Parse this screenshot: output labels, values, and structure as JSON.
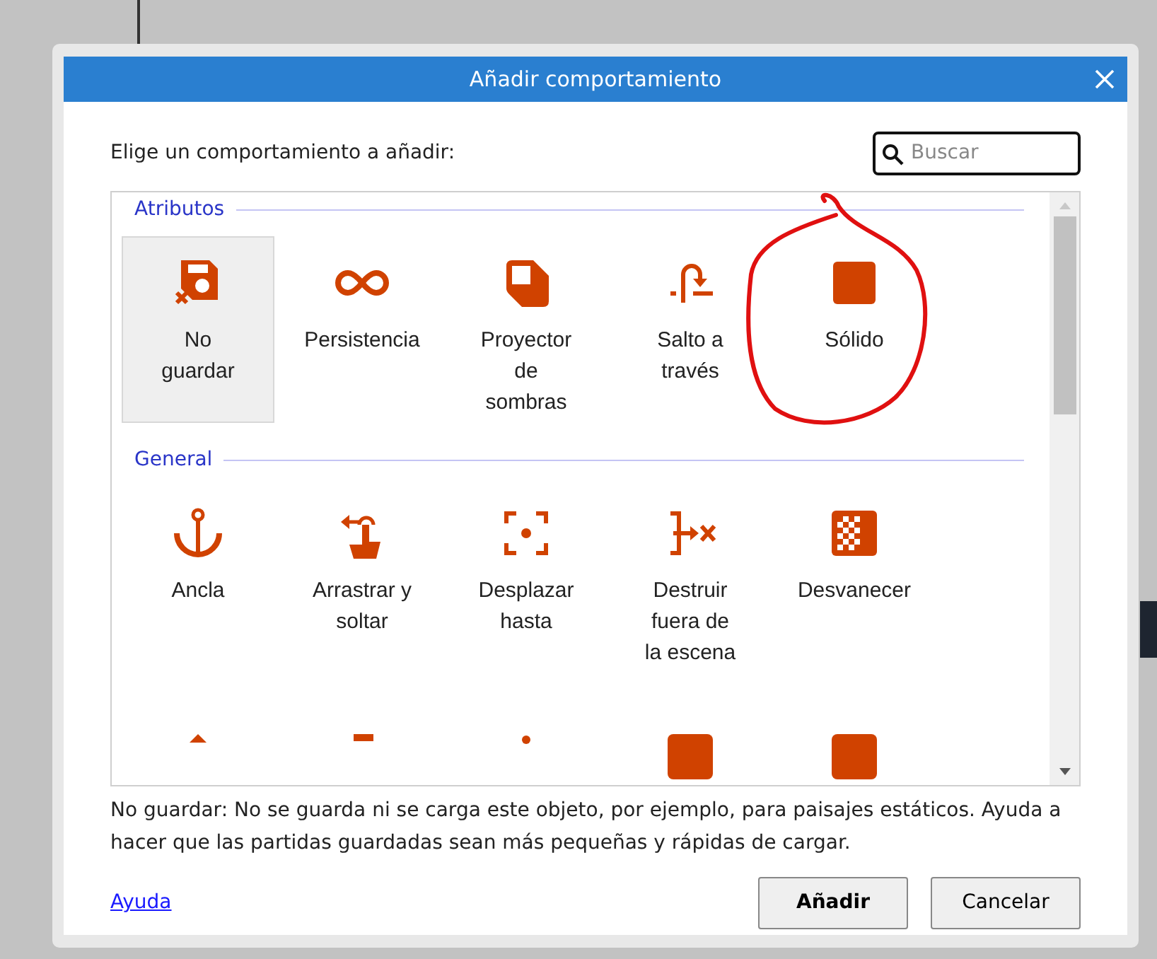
{
  "window": {
    "title": "Añadir comportamiento"
  },
  "prompt": "Elige un comportamiento a añadir:",
  "search": {
    "placeholder": "Buscar"
  },
  "groups": [
    {
      "title": "Atributos",
      "items": [
        {
          "label": "No guardar",
          "kind": "nosave",
          "selected": true
        },
        {
          "label": "Persistencia",
          "kind": "infinity",
          "selected": false
        },
        {
          "label": "Proyector de sombras",
          "kind": "shadow",
          "selected": false
        },
        {
          "label": "Salto a través",
          "kind": "jumpthru",
          "selected": false
        },
        {
          "label": "Sólido",
          "kind": "solid",
          "selected": false
        }
      ]
    },
    {
      "title": "General",
      "items": [
        {
          "label": "Ancla",
          "kind": "anchor",
          "selected": false
        },
        {
          "label": "Arrastrar y soltar",
          "kind": "drag",
          "selected": false
        },
        {
          "label": "Desplazar hasta",
          "kind": "scrollto",
          "selected": false
        },
        {
          "label": "Destruir fuera de la escena",
          "kind": "destroy",
          "selected": false
        },
        {
          "label": "Desvanecer",
          "kind": "fade",
          "selected": false
        },
        {
          "kind": "peak",
          "selected": false
        },
        {
          "kind": "flag",
          "selected": false
        },
        {
          "kind": "dot",
          "selected": false
        },
        {
          "kind": "bar",
          "selected": false
        },
        {
          "kind": "bar",
          "selected": false
        }
      ]
    }
  ],
  "description": "No guardar: No se guarda ni se carga este objeto, por ejemplo, para paisajes estáticos. Ayuda a hacer que las partidas guardadas sean más pequeñas y rápidas de cargar.",
  "help_link": "Ayuda",
  "buttons": [
    {
      "label": "Añadir",
      "default": true
    },
    {
      "label": "Cancelar",
      "default": false
    }
  ]
}
